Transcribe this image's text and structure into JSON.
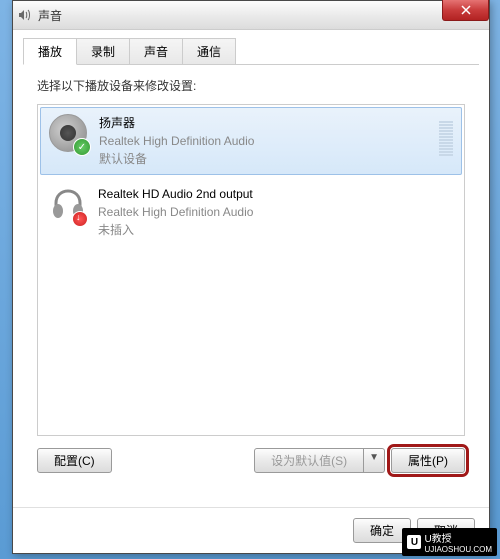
{
  "window": {
    "title": "声音"
  },
  "tabs": [
    {
      "label": "播放",
      "active": true
    },
    {
      "label": "录制",
      "active": false
    },
    {
      "label": "声音",
      "active": false
    },
    {
      "label": "通信",
      "active": false
    }
  ],
  "instruction": "选择以下播放设备来修改设置:",
  "devices": [
    {
      "name": "扬声器",
      "description": "Realtek High Definition Audio",
      "status": "默认设备",
      "selected": true,
      "badge": "check"
    },
    {
      "name": "Realtek HD Audio 2nd output",
      "description": "Realtek High Definition Audio",
      "status": "未插入",
      "selected": false,
      "badge": "error"
    }
  ],
  "buttons": {
    "configure": "配置(C)",
    "set_default": "设为默认值(S)",
    "properties": "属性(P)",
    "ok": "确定",
    "cancel": "取消"
  },
  "watermark": {
    "icon": "U",
    "text1": "U教授",
    "text2": "UJIAOSHOU.COM"
  }
}
